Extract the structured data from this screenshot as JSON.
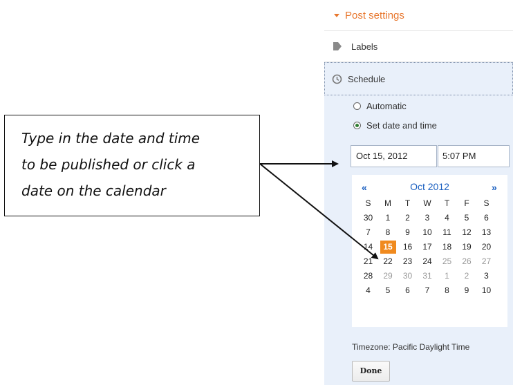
{
  "sidebar": {
    "post_settings_label": "Post settings",
    "labels_label": "Labels",
    "schedule_label": "Schedule",
    "radio_automatic": "Automatic",
    "radio_set_date": "Set date and time",
    "selected_radio": "Set date and time",
    "date_value": "Oct 15, 2012",
    "time_value": "5:07 PM",
    "timezone_text": "Timezone: Pacific Daylight Time",
    "done_label": "Done",
    "accent_color": "#e8772e"
  },
  "calendar": {
    "prev_label": "«",
    "next_label": "»",
    "month_title": "Oct 2012",
    "weekdays": [
      "S",
      "M",
      "T",
      "W",
      "T",
      "F",
      "S"
    ],
    "weeks": [
      [
        "30",
        "1",
        "2",
        "3",
        "4",
        "5",
        "6"
      ],
      [
        "7",
        "8",
        "9",
        "10",
        "11",
        "12",
        "13"
      ],
      [
        "14",
        "15",
        "16",
        "17",
        "18",
        "19",
        "20"
      ],
      [
        "21",
        "22",
        "23",
        "24",
        "25",
        "26",
        "27"
      ],
      [
        "28",
        "29",
        "30",
        "31",
        "1",
        "2",
        "3"
      ],
      [
        "4",
        "5",
        "6",
        "7",
        "8",
        "9",
        "10"
      ]
    ],
    "other_month_days": [
      [
        4,
        4
      ],
      [
        4,
        5
      ],
      [
        4,
        6
      ],
      [
        5,
        1
      ],
      [
        5,
        2
      ],
      [
        5,
        3
      ],
      [
        5,
        4
      ],
      [
        5,
        5
      ]
    ],
    "selected_day": "15",
    "selected_color": "#f08a1e"
  },
  "callout": {
    "line1": "Type in the date and time",
    "line2": "to be published or click a",
    "line3": "date on the calendar"
  }
}
